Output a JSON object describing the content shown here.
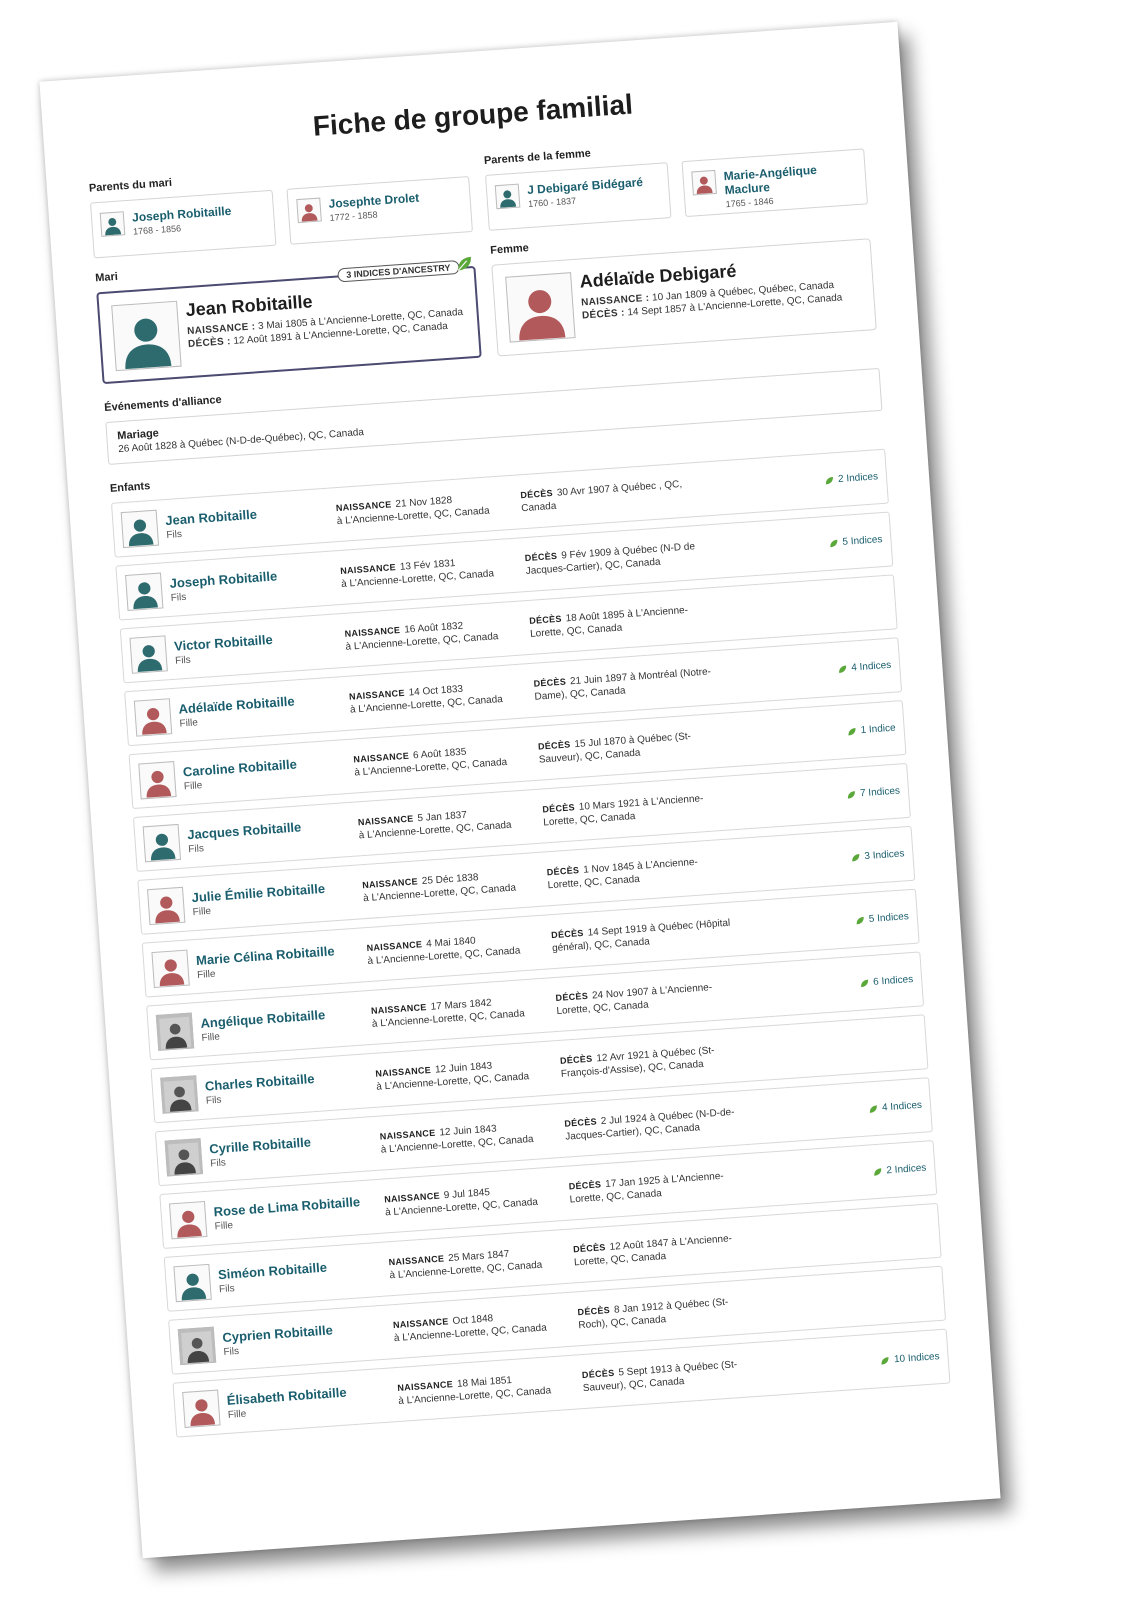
{
  "title": "Fiche de groupe familial",
  "colors": {
    "male": "#2e6b6f",
    "female": "#b2595b",
    "link": "#1a5e6e",
    "leaf": "#5ba83a"
  },
  "husband_parents": {
    "label": "Parents du mari",
    "items": [
      {
        "name": "Joseph Robitaille",
        "dates": "1768 - 1856",
        "gender": "male"
      },
      {
        "name": "Josephte Drolet",
        "dates": "1772 - 1858",
        "gender": "female"
      }
    ]
  },
  "wife_parents": {
    "label": "Parents de la femme",
    "items": [
      {
        "name": "J Debigaré Bidégaré",
        "dates": "1760 - 1837",
        "gender": "male"
      },
      {
        "name": "Marie-Angélique Maclure",
        "dates": "1765 - 1846",
        "gender": "female"
      }
    ]
  },
  "husband": {
    "label": "Mari",
    "hints_badge": "3 INDICES D'ANCESTRY",
    "name": "Jean Robitaille",
    "birth_label": "NAISSANCE :",
    "birth": "3 Mai 1805 à L'Ancienne-Lorette, QC, Canada",
    "death_label": "DÉCÈS :",
    "death": "12 Août 1891 à L'Ancienne-Lorette, QC, Canada"
  },
  "wife": {
    "label": "Femme",
    "name": "Adélaïde Debigaré",
    "birth_label": "NAISSANCE :",
    "birth": "10 Jan 1809 à Québec, Québec, Canada",
    "death_label": "DÉCÈS :",
    "death": "14 Sept 1857 à L'Ancienne-Lorette, QC, Canada"
  },
  "alliance": {
    "label": "Événements d'alliance",
    "event": "Mariage",
    "details": "26 Août 1828 à Québec (N-D-de-Québec), QC, Canada"
  },
  "children_label": "Enfants",
  "birth_label": "NAISSANCE",
  "death_label": "DÉCÈS",
  "children": [
    {
      "name": "Jean Robitaille",
      "role": "Fils",
      "gender": "male",
      "birth_date": "21 Nov 1828",
      "birth_place": "à L'Ancienne-Lorette, QC, Canada",
      "death_date": "30 Avr 1907",
      "death_place": "à Québec , QC, Canada",
      "hints": "2 Indices"
    },
    {
      "name": "Joseph Robitaille",
      "role": "Fils",
      "gender": "male",
      "birth_date": "13 Fév 1831",
      "birth_place": "à L'Ancienne-Lorette, QC, Canada",
      "death_date": "9 Fév 1909",
      "death_place": "à Québec (N-D de Jacques-Cartier), QC, Canada",
      "hints": "5 Indices"
    },
    {
      "name": "Victor Robitaille",
      "role": "Fils",
      "gender": "male",
      "birth_date": "16 Août 1832",
      "birth_place": "à L'Ancienne-Lorette, QC, Canada",
      "death_date": "18 Août 1895",
      "death_place": "à L'Ancienne-Lorette, QC, Canada",
      "hints": ""
    },
    {
      "name": "Adélaïde Robitaille",
      "role": "Fille",
      "gender": "female",
      "birth_date": "14 Oct 1833",
      "birth_place": "à L'Ancienne-Lorette, QC, Canada",
      "death_date": "21 Juin 1897",
      "death_place": "à Montréal (Notre-Dame), QC, Canada",
      "hints": "4 Indices"
    },
    {
      "name": "Caroline Robitaille",
      "role": "Fille",
      "gender": "female",
      "birth_date": "6 Août 1835",
      "birth_place": "à L'Ancienne-Lorette, QC, Canada",
      "death_date": "15 Jul 1870",
      "death_place": "à Québec (St-Sauveur), QC, Canada",
      "hints": "1 Indice"
    },
    {
      "name": "Jacques Robitaille",
      "role": "Fils",
      "gender": "male",
      "birth_date": "5 Jan 1837",
      "birth_place": "à L'Ancienne-Lorette, QC, Canada",
      "death_date": "10 Mars 1921",
      "death_place": "à L'Ancienne-Lorette, QC, Canada",
      "hints": "7 Indices"
    },
    {
      "name": "Julie Émilie Robitaille",
      "role": "Fille",
      "gender": "female",
      "birth_date": "25 Déc 1838",
      "birth_place": "à L'Ancienne-Lorette, QC, Canada",
      "death_date": "1 Nov 1845",
      "death_place": "à L'Ancienne-Lorette, QC, Canada",
      "hints": "3 Indices"
    },
    {
      "name": "Marie Célina Robitaille",
      "role": "Fille",
      "gender": "female",
      "birth_date": "4 Mai 1840",
      "birth_place": "à L'Ancienne-Lorette, QC, Canada",
      "death_date": "14 Sept 1919",
      "death_place": "à Québec (Hôpital général), QC, Canada",
      "hints": "5 Indices"
    },
    {
      "name": "Angélique Robitaille",
      "role": "Fille",
      "gender": "photo",
      "birth_date": "17 Mars 1842",
      "birth_place": "à L'Ancienne-Lorette, QC, Canada",
      "death_date": "24 Nov 1907",
      "death_place": "à L'Ancienne-Lorette, QC, Canada",
      "hints": "6 Indices"
    },
    {
      "name": "Charles Robitaille",
      "role": "Fils",
      "gender": "photo",
      "birth_date": "12 Juin 1843",
      "birth_place": "à L'Ancienne-Lorette, QC, Canada",
      "death_date": "12 Avr 1921",
      "death_place": "à Québec (St-François-d'Assise), QC, Canada",
      "hints": ""
    },
    {
      "name": "Cyrille Robitaille",
      "role": "Fils",
      "gender": "photo",
      "birth_date": "12 Juin 1843",
      "birth_place": "à L'Ancienne-Lorette, QC, Canada",
      "death_date": "2 Jul 1924",
      "death_place": "à Québec (N-D-de-Jacques-Cartier), QC, Canada",
      "hints": "4 Indices"
    },
    {
      "name": "Rose de Lima Robitaille",
      "role": "Fille",
      "gender": "female",
      "birth_date": "9 Jul 1845",
      "birth_place": "à L'Ancienne-Lorette, QC, Canada",
      "death_date": "17 Jan 1925",
      "death_place": "à L'Ancienne-Lorette, QC, Canada",
      "hints": "2 Indices"
    },
    {
      "name": "Siméon Robitaille",
      "role": "Fils",
      "gender": "male",
      "birth_date": "25 Mars 1847",
      "birth_place": "à L'Ancienne-Lorette, QC, Canada",
      "death_date": "12 Août 1847",
      "death_place": "à L'Ancienne-Lorette, QC, Canada",
      "hints": ""
    },
    {
      "name": "Cyprien Robitaille",
      "role": "Fils",
      "gender": "photo",
      "birth_date": "Oct 1848",
      "birth_place": "à L'Ancienne-Lorette, QC, Canada",
      "death_date": "8 Jan 1912",
      "death_place": "à Québec (St-Roch), QC, Canada",
      "hints": ""
    },
    {
      "name": "Élisabeth Robitaille",
      "role": "Fille",
      "gender": "female",
      "birth_date": "18 Mai 1851",
      "birth_place": "à L'Ancienne-Lorette, QC, Canada",
      "death_date": "5 Sept 1913",
      "death_place": "à Québec (St-Sauveur), QC, Canada",
      "hints": "10 Indices"
    }
  ]
}
